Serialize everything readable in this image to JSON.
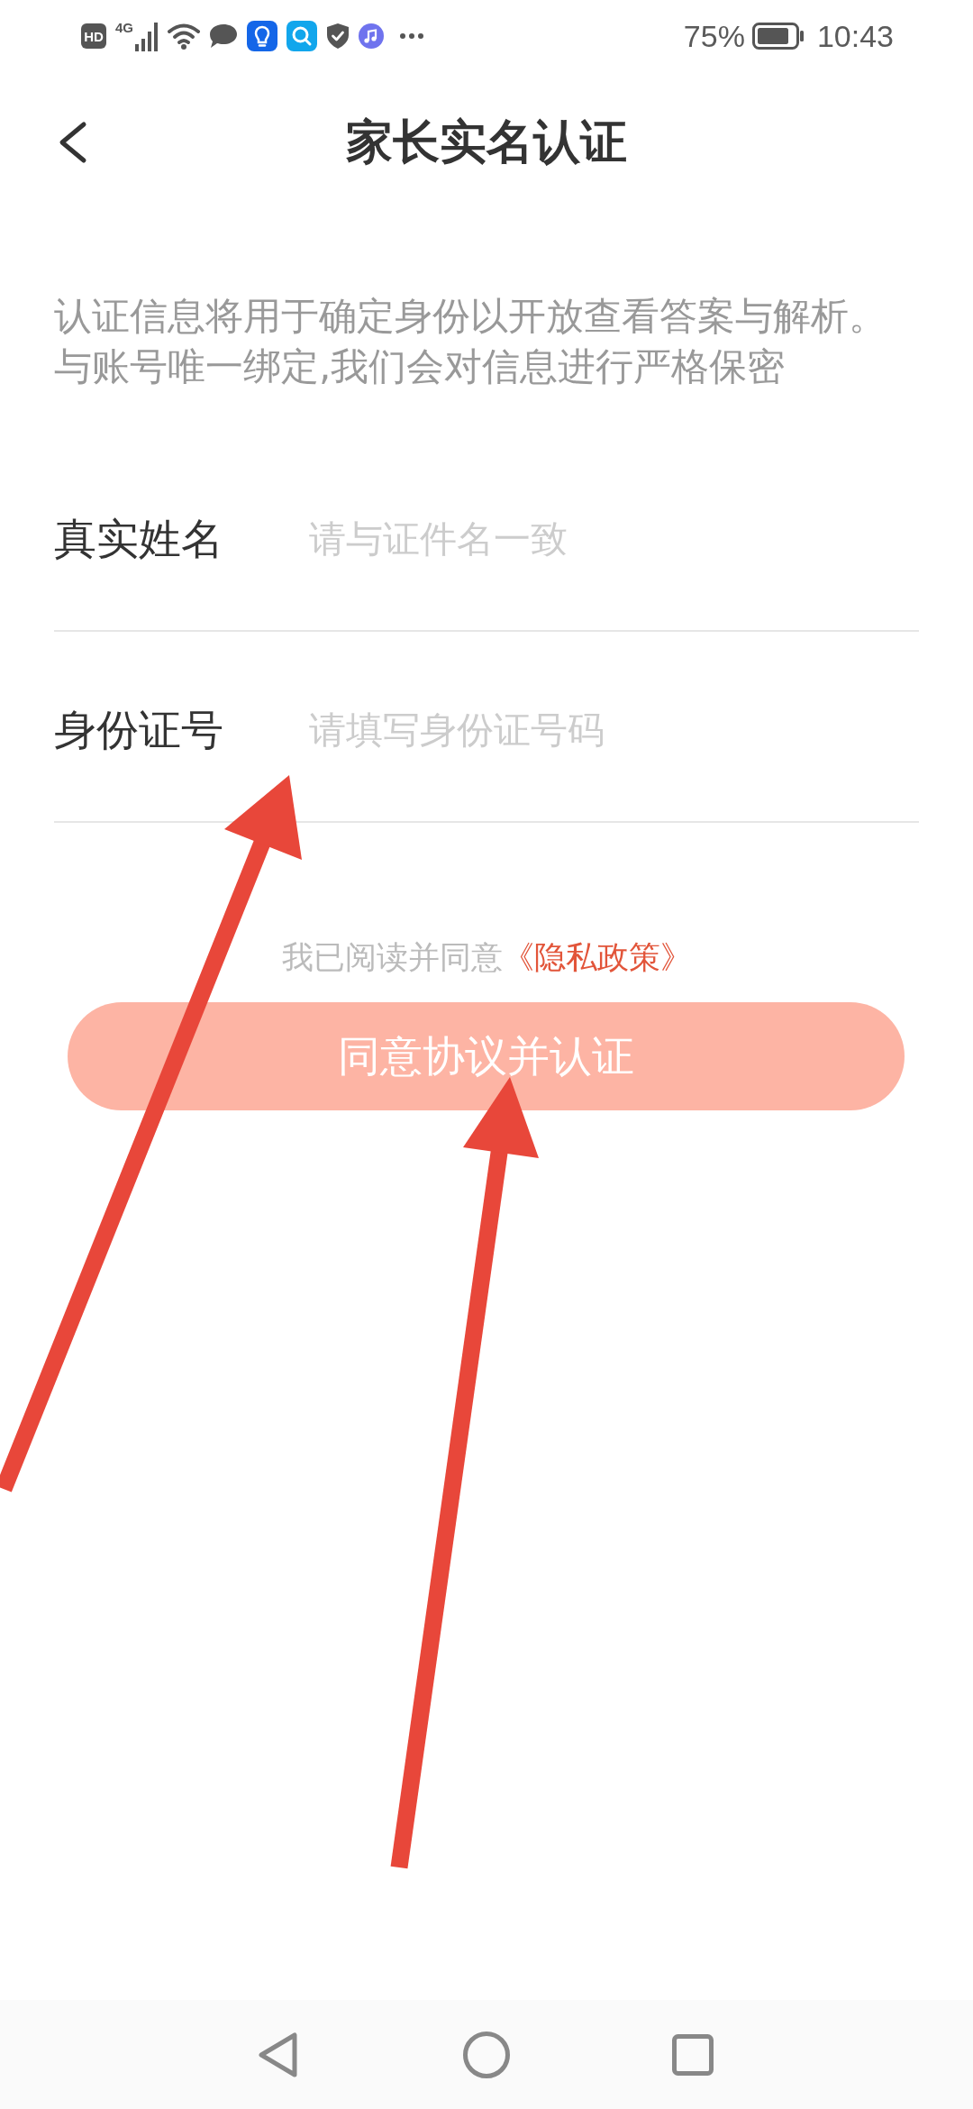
{
  "status_bar": {
    "hd_badge": "HD",
    "network_type": "4G",
    "battery_percent": "75%",
    "time": "10:43"
  },
  "header": {
    "title": "家长实名认证"
  },
  "notice": [
    "认证信息将用于确定身份以开放查看答案与解析。",
    "与账号唯一绑定,我们会对信息进行严格保密"
  ],
  "form": {
    "fields": [
      {
        "label": "真实姓名",
        "placeholder": "请与证件名一致"
      },
      {
        "label": "身份证号",
        "placeholder": "请填写身份证号码"
      }
    ]
  },
  "agreement": {
    "text": "我已阅读并同意",
    "link": "《隐私政策》"
  },
  "submit_button": {
    "label": "同意协议并认证",
    "disabled": true
  }
}
